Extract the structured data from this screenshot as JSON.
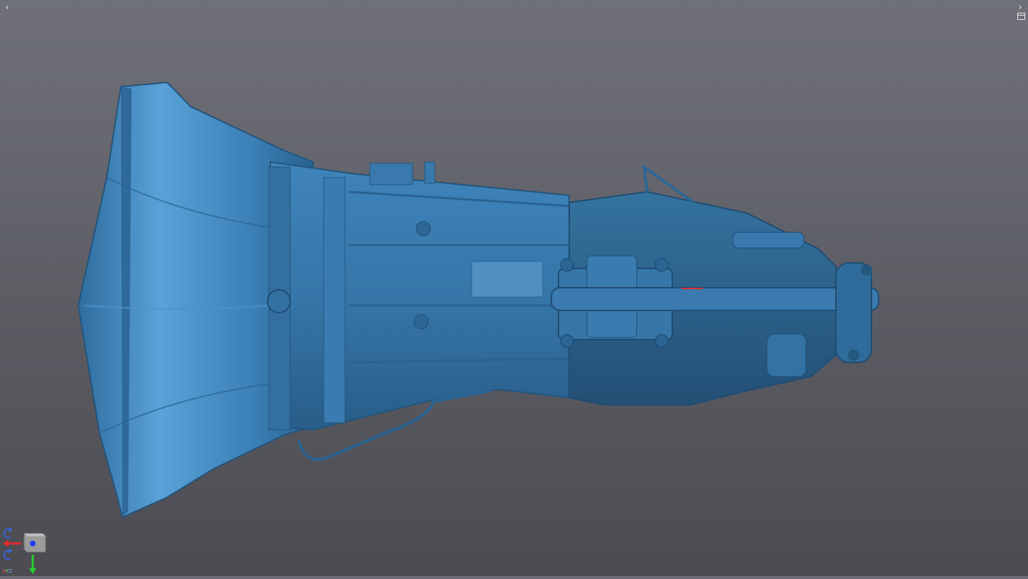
{
  "viewer": {
    "prev_glyph": "‹",
    "next_glyph": "›",
    "panel_icon": "panel-toggle-icon",
    "model": "transmission-3d-scan",
    "model_color": "#3a77a8",
    "background_color": "#66676e"
  },
  "axes": {
    "x_label": "X",
    "y_label": "Y",
    "z_label": "Z",
    "x_color": "#e52b2b",
    "y_color": "#2bd12b",
    "z_color": "#1f3cff"
  }
}
